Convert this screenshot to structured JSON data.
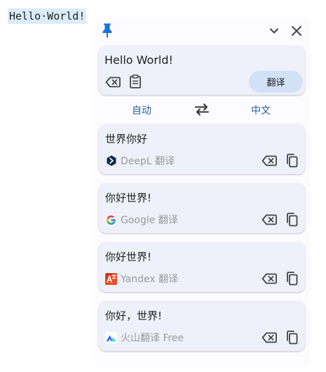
{
  "editor": {
    "selected_text": "Hello·World!"
  },
  "popup": {
    "header": {
      "pin_icon": "pin-icon",
      "collapse_icon": "chevron-down-icon",
      "close_icon": "close-icon"
    },
    "source": {
      "value": "Hello World!",
      "clear_icon": "backspace-icon",
      "paste_icon": "clipboard-icon",
      "translate_label": "翻译"
    },
    "languages": {
      "from": "自动",
      "to": "中文",
      "swap_icon": "swap-icon"
    },
    "results": [
      {
        "text": "世界你好",
        "service": "DeepL 翻译",
        "logo": "deepl-logo-icon"
      },
      {
        "text": "你好世界!",
        "service": "Google 翻译",
        "logo": "google-logo-icon"
      },
      {
        "text": "你好世界!",
        "service": "Yandex 翻译",
        "logo": "yandex-logo-icon"
      },
      {
        "text": "你好，世界!",
        "service": "火山翻译 Free",
        "logo": "volcengine-logo-icon"
      }
    ]
  },
  "colors": {
    "panel_bg": "#fcfbff",
    "card_bg": "#eef1f9",
    "translate_button_bg": "#d3e1f6",
    "language_link": "#2a5f95",
    "pin": "#1a73d9",
    "service_text": "#9a9a9a",
    "selection_bg": "#dcecfb"
  }
}
